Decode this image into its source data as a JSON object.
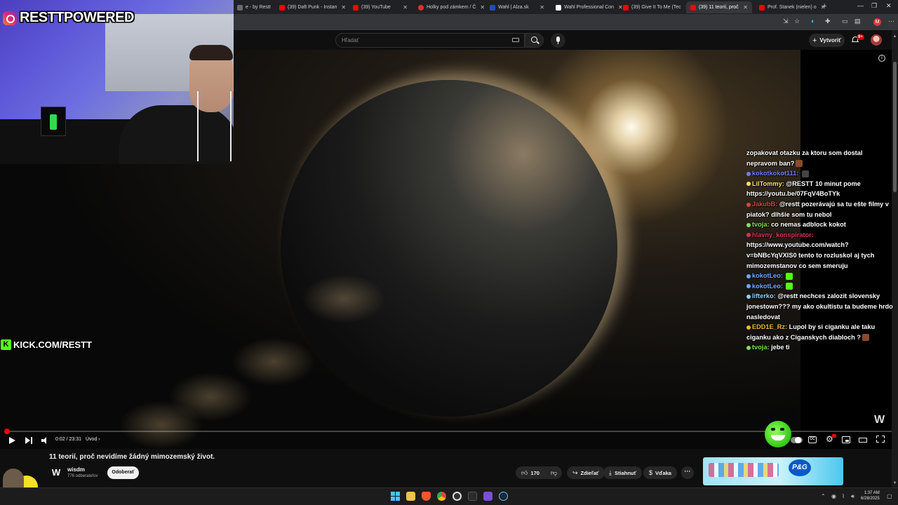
{
  "browser": {
    "tabs": [
      {
        "label": "e - by Restt",
        "color": "#6b6b6b",
        "active": false
      },
      {
        "label": "(39) Daft Punk - Instan",
        "color": "#ff0000",
        "active": false
      },
      {
        "label": "(39) YouTube",
        "color": "#ff0000",
        "active": false
      },
      {
        "label": "Holky pod zámkem / Č",
        "color": "#e03030",
        "active": false
      },
      {
        "label": "Wahl | Alza.sk",
        "color": "#1d4fb8",
        "active": false
      },
      {
        "label": "Wahl Professional Con",
        "color": "#ffffff",
        "active": false
      },
      {
        "label": "(39) Give It To Me (Tec",
        "color": "#ff0000",
        "active": false
      },
      {
        "label": "(39) 11 teorií, proč",
        "color": "#ff0000",
        "active": true
      },
      {
        "label": "Prof. Stanek (nielen) o",
        "color": "#ff0000",
        "active": false
      }
    ],
    "new_tab": "+",
    "profile_initial": "M"
  },
  "youtube": {
    "search_placeholder": "Hľadať",
    "create_label": "Vytvoriť",
    "notifications_count": "9+"
  },
  "player": {
    "time": "0:02 / 23:31",
    "chapter": "Úvod",
    "progress": 0.0014,
    "logo": "W"
  },
  "overlay": {
    "instagram": "RESTTPOWERED",
    "kick": "KICK.COM/RESTT",
    "kick_icon": "K"
  },
  "chat": [
    {
      "user": "",
      "text": "zopakovat otazku za ktoru som dostal nepravom ban?",
      "user_color": "#ffffff",
      "emote": "#8b4a2b"
    },
    {
      "user": "kokotkokot111",
      "text": "",
      "user_color": "#6b7cff",
      "emote": "#444444"
    },
    {
      "user": "LilTommy",
      "text": "@RESTT 10 minut pome https://youtu.be/07FqV4BoTYk",
      "user_color": "#f5e663",
      "emote": ""
    },
    {
      "user": "JakubB",
      "text": "@restt pozerávajú sa tu ešte filmy v piatok? dlhšie som tu nebol",
      "user_color": "#d64545",
      "emote": ""
    },
    {
      "user": "tvoja",
      "text": "co nemas adblock kokot",
      "user_color": "#7fe05a",
      "emote": ""
    },
    {
      "user": "hlavny_konspirator",
      "text": "https://www.youtube.com/watch?v=bNBcYqVXIS0 tento to rozluskol aj tych mimozemstanov co sem smeruju",
      "user_color": "#d8305a",
      "emote": ""
    },
    {
      "user": "kokotLeo",
      "text": "",
      "user_color": "#6fa8ff",
      "emote": "#53fc18"
    },
    {
      "user": "kokotLeo",
      "text": "",
      "user_color": "#6fa8ff",
      "emote": "#53fc18"
    },
    {
      "user": "lifterko",
      "text": "@restt nechces zalozit slovensky jonestown??? my ako okultistu ta budeme hrdo nasledovat",
      "user_color": "#8fd0ff",
      "emote": ""
    },
    {
      "user": "EDD1E_Rz",
      "text": "Lupol by si ciganku ale taku ciganku ako z Ciganskych diabloch ?",
      "user_color": "#f2b43a",
      "emote": "#8b4a2b"
    },
    {
      "user": "tvoja",
      "text": "jebe ti",
      "user_color": "#7fe05a",
      "emote": ""
    }
  ],
  "video_info": {
    "title": "11 teorií, proč nevidíme žádný mimozemský život.",
    "channel": "wisdm",
    "channel_initial": "W",
    "subscribers": "776 odberateľov",
    "subscribe_label": "Odoberať",
    "likes": "170",
    "share_label": "Zdieľať",
    "download_label": "Stiahnuť",
    "thanks_label": "Vďaka",
    "more_label": "···"
  },
  "ad": {
    "brand": "P&G"
  },
  "clock": {
    "time": "1:37 AM",
    "date": "6/28/2025"
  }
}
